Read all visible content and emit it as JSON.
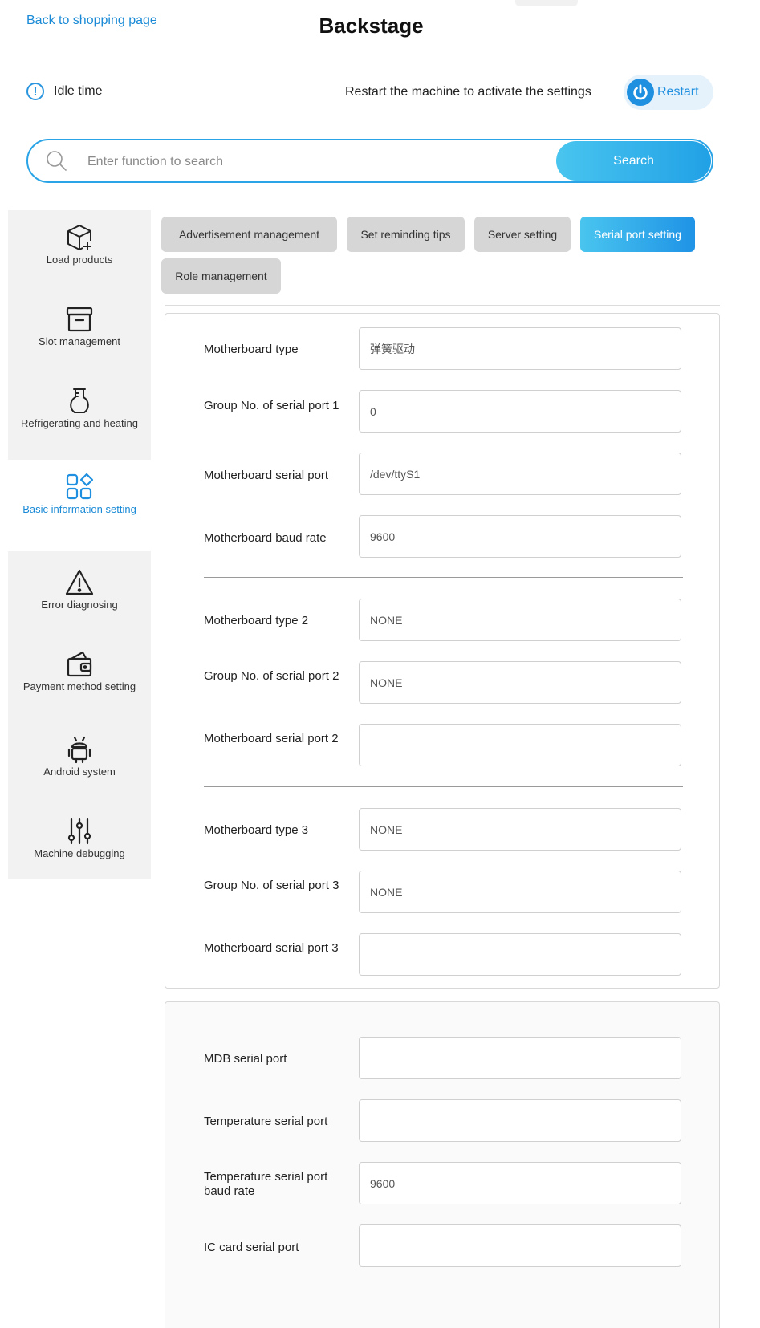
{
  "header": {
    "back_link": "Back to shopping page",
    "title": "Backstage",
    "idle_label": "Idle time",
    "restart_message": "Restart the machine to activate the settings",
    "restart_button": "Restart"
  },
  "search": {
    "placeholder": "Enter function to search",
    "button": "Search"
  },
  "sidebar": {
    "items": [
      {
        "label": "Load products",
        "icon": "box-plus-icon"
      },
      {
        "label": "Slot management",
        "icon": "drawer-icon"
      },
      {
        "label": "Refrigerating and heating",
        "icon": "flask-icon"
      },
      {
        "label": "Basic information setting",
        "icon": "apps-icon",
        "active": true
      },
      {
        "label": "Error diagnosing",
        "icon": "warning-icon"
      },
      {
        "label": "Payment method setting",
        "icon": "wallet-icon"
      },
      {
        "label": "Android system",
        "icon": "android-icon"
      },
      {
        "label": "Machine debugging",
        "icon": "sliders-icon"
      }
    ]
  },
  "tabs": [
    {
      "label": "Advertisement management"
    },
    {
      "label": "Set reminding tips"
    },
    {
      "label": "Server setting"
    },
    {
      "label": "Serial port setting",
      "active": true
    },
    {
      "label": "Role management"
    }
  ],
  "serial_form": {
    "rows": [
      {
        "label": "Motherboard type",
        "value": "弹簧驱动"
      },
      {
        "label": "Group No. of serial port 1",
        "value": "0"
      },
      {
        "label": "Motherboard serial port",
        "value": "/dev/ttyS1"
      },
      {
        "label": "Motherboard baud rate",
        "value": "9600"
      },
      {
        "label": "Motherboard type 2",
        "value": "NONE"
      },
      {
        "label": "Group No. of serial port 2",
        "value": "NONE"
      },
      {
        "label": "Motherboard serial port 2",
        "value": ""
      },
      {
        "label": "Motherboard type 3",
        "value": "NONE"
      },
      {
        "label": "Group No. of serial port 3",
        "value": "NONE"
      },
      {
        "label": "Motherboard serial port 3",
        "value": ""
      }
    ]
  },
  "peripheral_form": {
    "rows": [
      {
        "label": "MDB serial port",
        "value": ""
      },
      {
        "label": "Temperature serial port",
        "value": ""
      },
      {
        "label": "Temperature serial port baud rate",
        "value": "9600"
      },
      {
        "label": "IC card serial port",
        "value": ""
      }
    ]
  },
  "colors": {
    "accent": "#1f8fe0",
    "tab_active": "#2aa4e6",
    "tab_inactive": "#d6d6d6",
    "sidebar_bg": "#f2f2f2"
  }
}
